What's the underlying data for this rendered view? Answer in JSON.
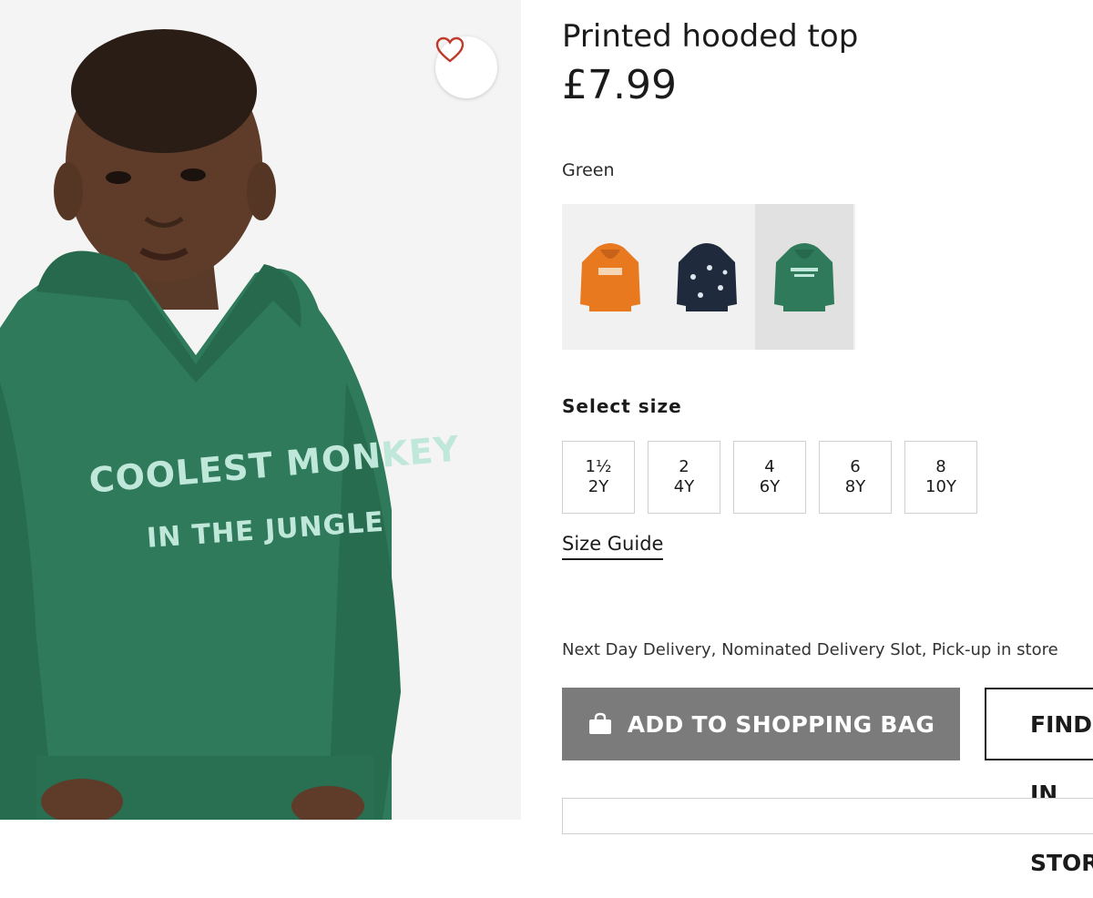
{
  "product": {
    "title": "Printed hooded top",
    "price": "£7.99",
    "selected_color": "Green",
    "hoodie_print_line1": "COOLEST MONKEY",
    "hoodie_print_line2": "IN THE JUNGLE",
    "favourite_icon": "heart-icon"
  },
  "colors": [
    {
      "name": "Orange",
      "hex": "#e8791f",
      "selected": false
    },
    {
      "name": "Navy",
      "hex": "#1f2a3c",
      "selected": false
    },
    {
      "name": "Green",
      "hex": "#2f7a5b",
      "selected": true
    }
  ],
  "sizes": {
    "label": "Select size",
    "options": [
      {
        "line1": "1½",
        "line2": "2Y"
      },
      {
        "line1": "2",
        "line2": "4Y"
      },
      {
        "line1": "4",
        "line2": "6Y"
      },
      {
        "line1": "6",
        "line2": "8Y"
      },
      {
        "line1": "8",
        "line2": "10Y"
      }
    ],
    "guide_link": "Size Guide"
  },
  "delivery": {
    "text": "Next Day Delivery, Nominated Delivery Slot, Pick-up in store"
  },
  "actions": {
    "add_to_bag": "ADD TO SHOPPING BAG",
    "add_to_bag_icon": "shopping-bag-icon",
    "find_in_store": "FIND IN STORE"
  },
  "theme": {
    "hoodie_green": "#2f7a5b",
    "button_gray": "#7b7b7b",
    "heart_red": "#c0392b"
  }
}
